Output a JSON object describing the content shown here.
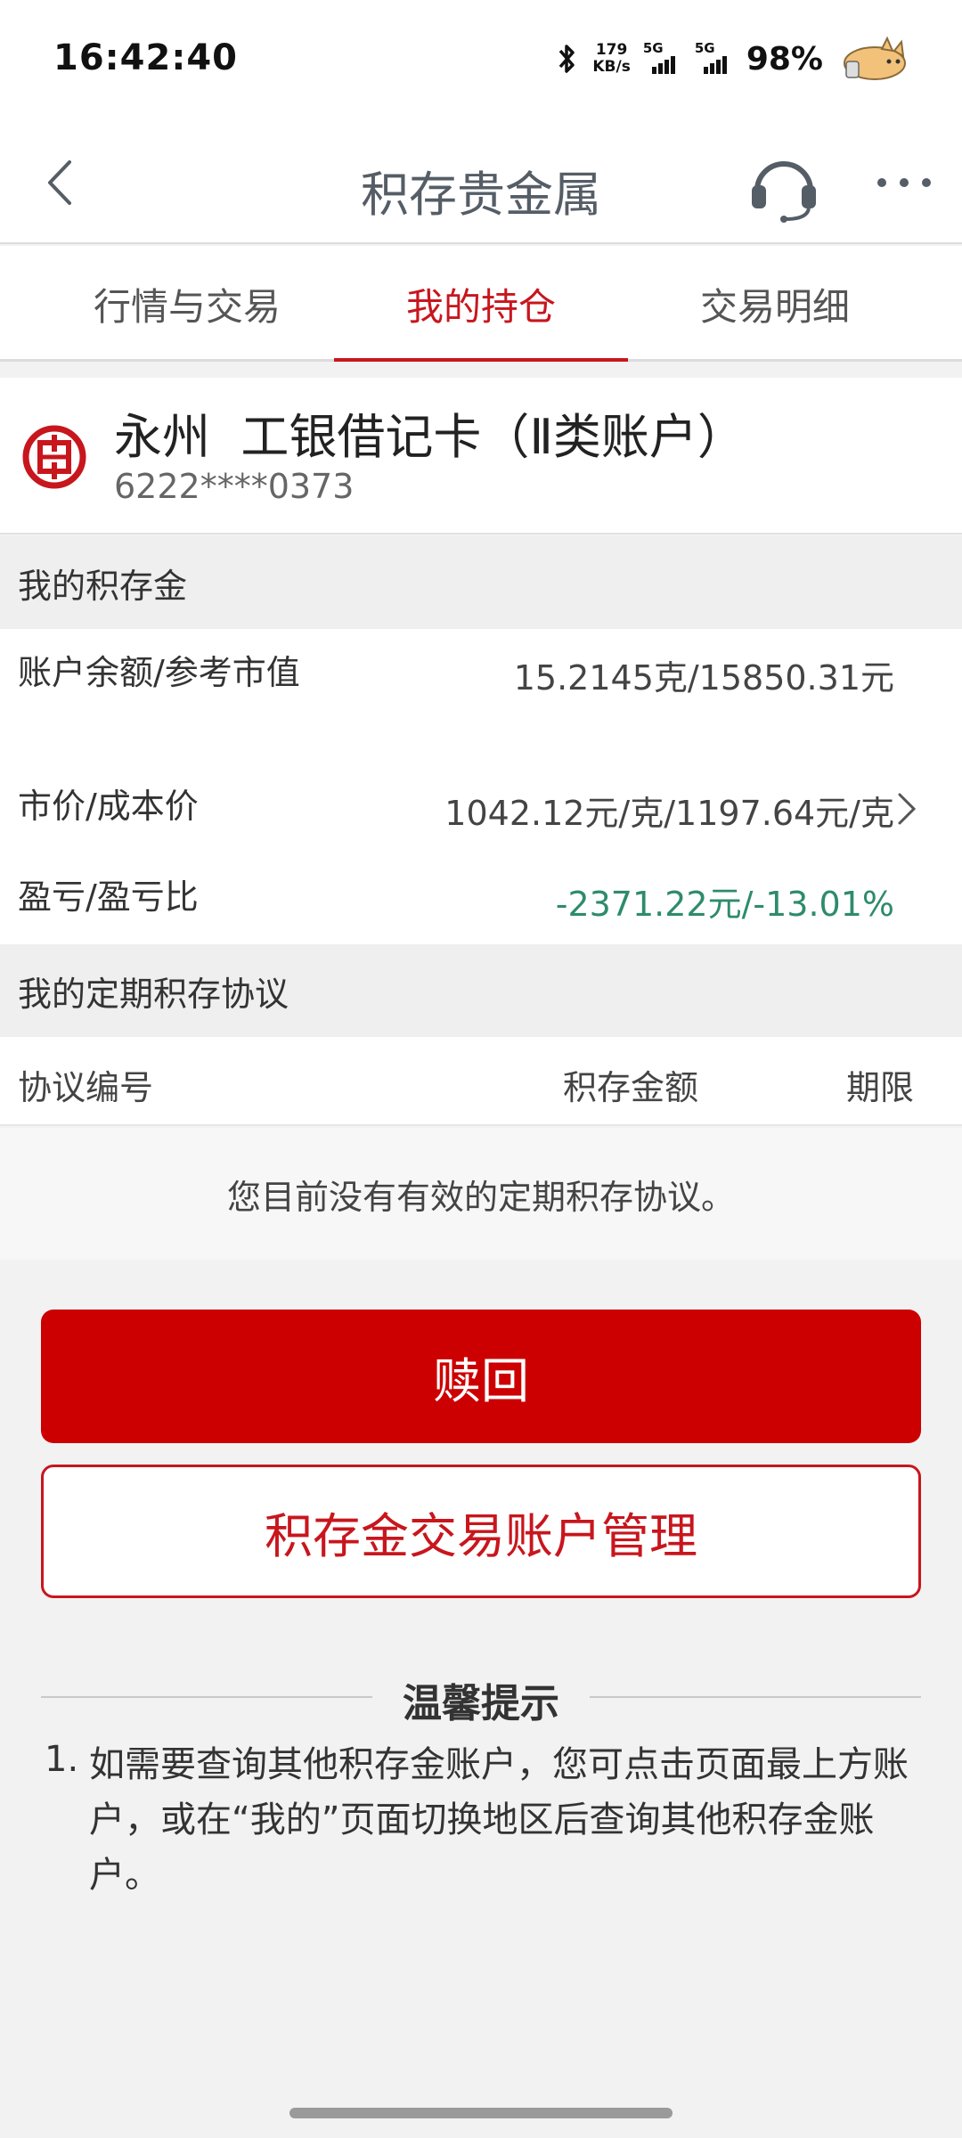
{
  "status_bar": {
    "time": "16:42:40",
    "net_speed_value": "179",
    "net_speed_unit": "KB/s",
    "signal1_label": "5G",
    "signal2_label": "5G",
    "battery": "98%",
    "icons": [
      "bluetooth-icon",
      "signal-icon",
      "signal-icon",
      "cat-sticker-icon"
    ]
  },
  "header": {
    "title": "积存贵金属",
    "icons": [
      "back-arrow-icon",
      "headset-support-icon",
      "more-dots-icon"
    ]
  },
  "tabs": [
    {
      "label": "行情与交易",
      "active": false
    },
    {
      "label": "我的持仓",
      "active": true
    },
    {
      "label": "交易明细",
      "active": false
    }
  ],
  "account": {
    "name": "永州  工银借记卡（Ⅱ类账户）",
    "number": "6222****0373",
    "logo_icon": "icbc-logo-icon"
  },
  "my_gold": {
    "section_title": "我的积存金",
    "rows": [
      {
        "label": "账户余额/参考市值",
        "value": "15.2145克/15850.31元"
      },
      {
        "label": "市价/成本价",
        "value": "1042.12元/克/1197.64元/克"
      },
      {
        "label": "盈亏/盈亏比",
        "value": "-2371.22元/-13.01%"
      }
    ]
  },
  "fixed_agreement": {
    "section_title": "我的定期积存协议",
    "columns": [
      "协议编号",
      "积存金额",
      "期限"
    ],
    "empty_text": "您目前没有有效的定期积存协议。"
  },
  "buttons": {
    "redeem": "赎回",
    "manage": "积存金交易账户管理"
  },
  "tips": {
    "title": "温馨提示",
    "items": [
      {
        "num": "1.",
        "text": "如需要查询其他积存金账户，您可点击页面最上方账户，或在“我的”页面切换地区后查询其他积存金账户。"
      }
    ]
  },
  "colors": {
    "brand_red": "#c8161d",
    "button_red": "#cc0000",
    "loss_green": "#2e8b6b"
  }
}
